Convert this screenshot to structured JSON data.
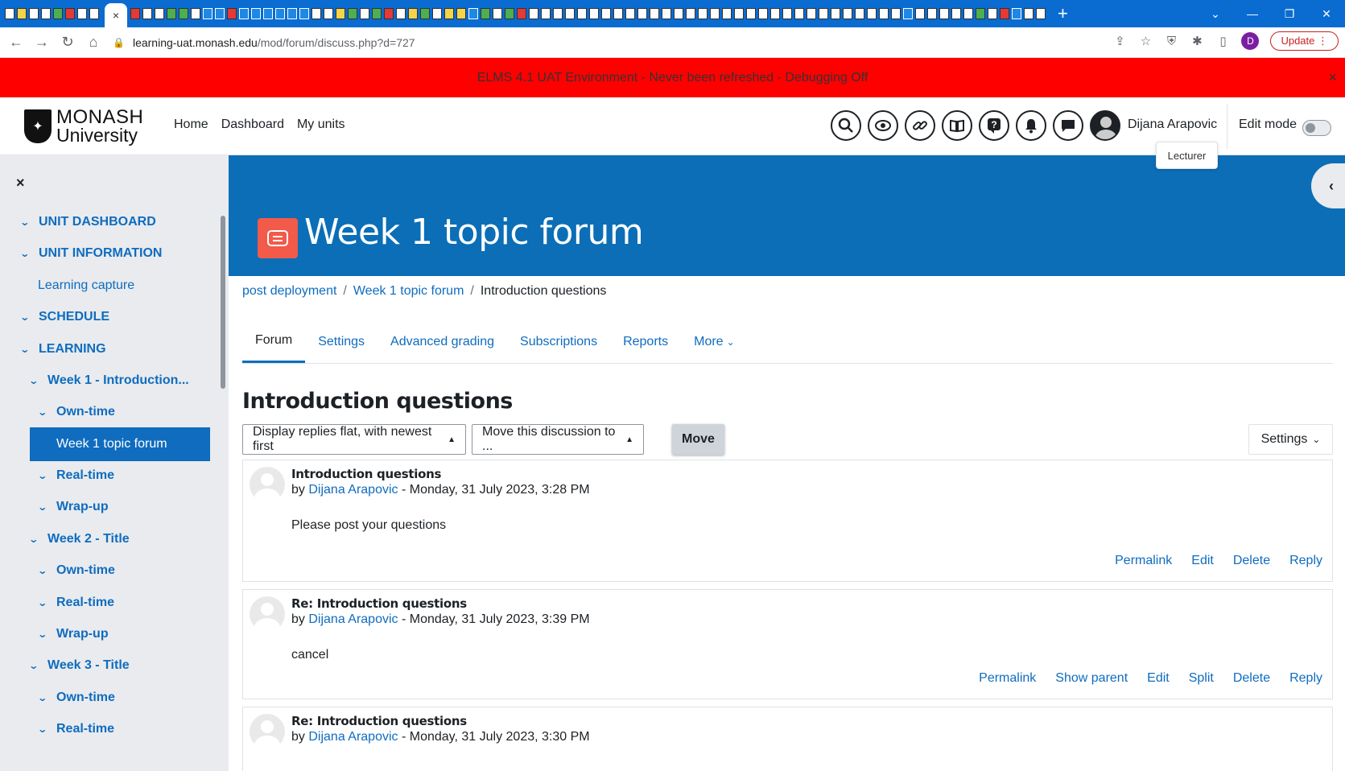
{
  "browser": {
    "tab_close_glyph": "×",
    "new_tab_glyph": "+",
    "window_controls": [
      "⌄",
      "—",
      "❐",
      "✕"
    ],
    "url_host": "learning-uat.monash.edu",
    "url_path": "/mod/forum/discuss.php?d=727",
    "profile_initial": "D",
    "update_label": "Update"
  },
  "env_banner": {
    "text": "ELMS 4.1 UAT Environment - Never been refreshed - Debugging Off",
    "close_glyph": "×"
  },
  "header": {
    "logo_line1": "MONASH",
    "logo_line2": "University",
    "nav": [
      "Home",
      "Dashboard",
      "My units"
    ],
    "user_name": "Dijana Arapovic",
    "edit_mode_label": "Edit mode",
    "edit_mode_on": false,
    "tooltip": "Lecturer",
    "icons": [
      "search-icon",
      "accessibility-icon",
      "link-icon",
      "book-icon",
      "help-icon",
      "notification-bell-icon",
      "messages-icon",
      "user-avatar-icon"
    ]
  },
  "drawer": {
    "close_glyph": "×",
    "items": [
      {
        "label": "UNIT DASHBOARD",
        "level": 0,
        "style": "section"
      },
      {
        "label": "UNIT INFORMATION",
        "level": 0,
        "style": "section"
      },
      {
        "label": "Learning capture",
        "level": 1,
        "style": "link"
      },
      {
        "label": "SCHEDULE",
        "level": 0,
        "style": "section"
      },
      {
        "label": "LEARNING",
        "level": 0,
        "style": "section"
      },
      {
        "label": "Week 1 - Introduction...",
        "level": 1,
        "style": "bold"
      },
      {
        "label": "Own-time",
        "level": 2,
        "style": "bold"
      },
      {
        "label": "Week 1 topic forum",
        "level": 3,
        "style": "active"
      },
      {
        "label": "Real-time",
        "level": 2,
        "style": "bold"
      },
      {
        "label": "Wrap-up",
        "level": 2,
        "style": "bold"
      },
      {
        "label": "Week 2 - Title",
        "level": 1,
        "style": "bold"
      },
      {
        "label": "Own-time",
        "level": 2,
        "style": "bold"
      },
      {
        "label": "Real-time",
        "level": 2,
        "style": "bold"
      },
      {
        "label": "Wrap-up",
        "level": 2,
        "style": "bold"
      },
      {
        "label": "Week 3 - Title",
        "level": 1,
        "style": "bold"
      },
      {
        "label": "Own-time",
        "level": 2,
        "style": "bold"
      },
      {
        "label": "Real-time",
        "level": 2,
        "style": "bold"
      }
    ]
  },
  "page": {
    "title": "Week 1 topic forum",
    "breadcrumb": [
      "post deployment",
      "Week 1 topic forum",
      "Introduction questions"
    ],
    "tabs": [
      "Forum",
      "Settings",
      "Advanced grading",
      "Subscriptions",
      "Reports",
      "More"
    ],
    "active_tab": "Forum",
    "discussion_title": "Introduction questions",
    "display_mode": "Display replies flat, with newest first",
    "move_select": "Move this discussion to ...",
    "move_button": "Move",
    "settings_button": "Settings"
  },
  "posts": [
    {
      "title": "Introduction questions",
      "by": "by",
      "author": "Dijana Arapovic",
      "date": "- Monday, 31 July 2023, 3:28 PM",
      "body": "Please post your questions",
      "actions": [
        "Permalink",
        "Edit",
        "Delete",
        "Reply"
      ]
    },
    {
      "title": "Re: Introduction questions",
      "by": "by",
      "author": "Dijana Arapovic",
      "date": "- Monday, 31 July 2023, 3:39 PM",
      "body": "cancel",
      "actions": [
        "Permalink",
        "Show parent",
        "Edit",
        "Split",
        "Delete",
        "Reply"
      ]
    },
    {
      "title": "Re: Introduction questions",
      "by": "by",
      "author": "Dijana Arapovic",
      "date": "- Monday, 31 July 2023, 3:30 PM",
      "body": "",
      "actions": []
    }
  ],
  "colors": {
    "banner_red": "#ff0000",
    "page_band_blue": "#0b6eb7",
    "link_blue": "#0f6cbf",
    "forum_icon_coral": "#f25a4a",
    "drawer_grey": "#e9ebee"
  }
}
